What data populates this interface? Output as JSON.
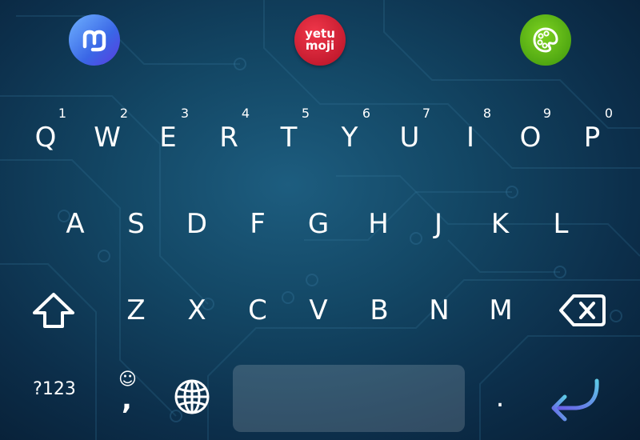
{
  "toolbar": {
    "yetumoji_line1": "yetu",
    "yetumoji_line2": "moji"
  },
  "rows": {
    "row1": [
      {
        "label": "Q",
        "hint": "1"
      },
      {
        "label": "W",
        "hint": "2"
      },
      {
        "label": "E",
        "hint": "3"
      },
      {
        "label": "R",
        "hint": "4"
      },
      {
        "label": "T",
        "hint": "5"
      },
      {
        "label": "Y",
        "hint": "6"
      },
      {
        "label": "U",
        "hint": "7"
      },
      {
        "label": "I",
        "hint": "8"
      },
      {
        "label": "O",
        "hint": "9"
      },
      {
        "label": "P",
        "hint": "0"
      }
    ],
    "row2": [
      "A",
      "S",
      "D",
      "F",
      "G",
      "H",
      "J",
      "K",
      "L"
    ],
    "row3": [
      "Z",
      "X",
      "C",
      "V",
      "B",
      "N",
      "M"
    ]
  },
  "bottom": {
    "symbols_label": "?123",
    "emoji_symbol": "☺",
    "comma_label": ",",
    "period_label": "."
  },
  "icons": {
    "mastodon": "mastodon-icon",
    "yetumoji": "yetumoji-icon",
    "theme": "palette-icon",
    "shift": "shift-arrow-icon",
    "backspace": "backspace-icon",
    "globe": "globe-icon",
    "enter": "enter-arrow-icon"
  },
  "colors": {
    "background_center": "#1d5d7f",
    "background_edge": "#071d33",
    "mastodon_accent": "#4a6cf0",
    "yetumoji_accent": "#d81f33",
    "theme_accent": "#5db514",
    "enter_gradient_start": "#5ec8e6",
    "enter_gradient_end": "#6a5ae8"
  }
}
